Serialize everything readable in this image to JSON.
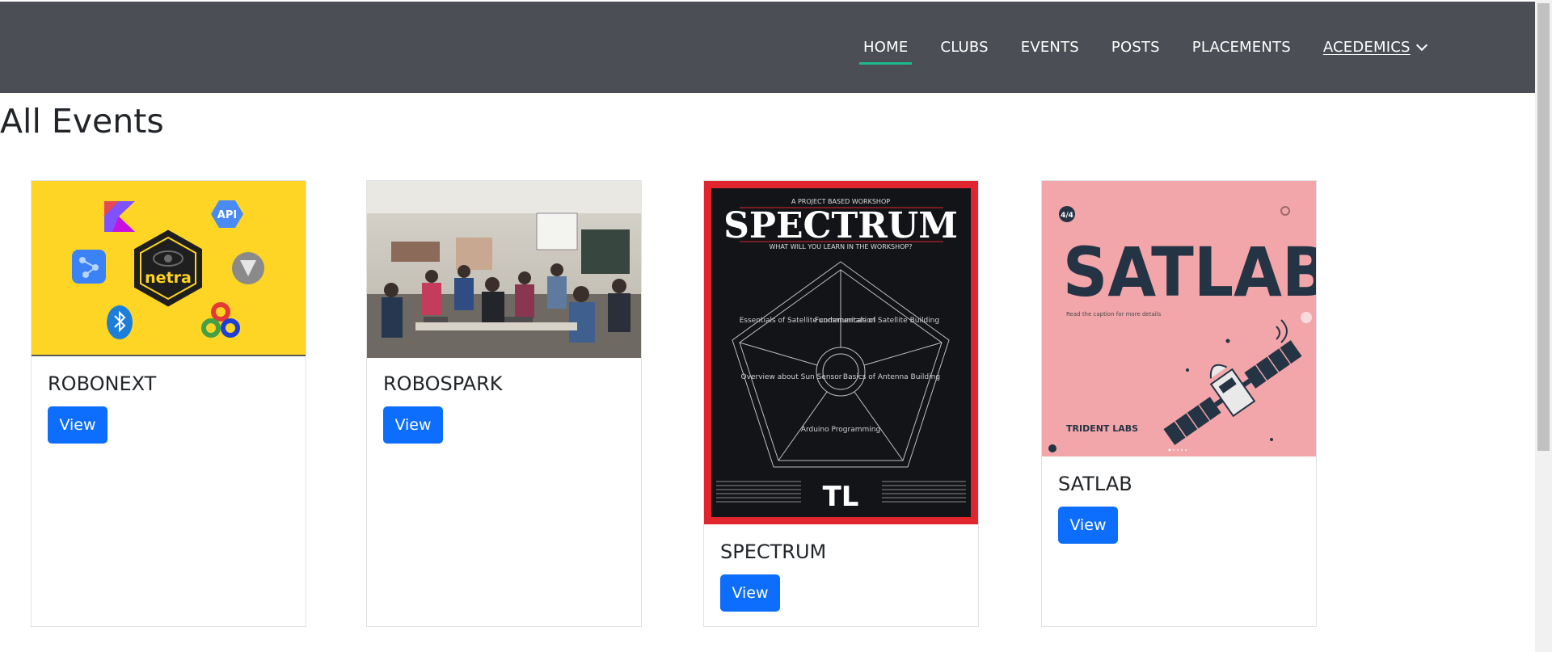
{
  "nav": {
    "home": "HOME",
    "clubs": "CLUBS",
    "events": "EVENTS",
    "posts": "POSTS",
    "placements": "PLACEMENTS",
    "academics": "ACEDEMICS"
  },
  "colors": {
    "navbar": "#4b4f55",
    "active_underline": "#1fb98f",
    "button": "#0d6efd"
  },
  "page": {
    "title": "All Events"
  },
  "events": [
    {
      "title": "ROBONEXT",
      "button": "View",
      "image": {
        "logo_text": "netra",
        "api_badge": "API"
      }
    },
    {
      "title": "ROBOSPARK",
      "button": "View",
      "image": {
        "description": "photo"
      }
    },
    {
      "title": "SPECTRUM",
      "button": "View",
      "image": {
        "kicker": "A PROJECT BASED WORKSHOP",
        "headline": "SPECTRUM",
        "subhead": "WHAT WILL YOU LEARN IN THE WORKSHOP?",
        "topics": [
          "Essentials of Satellite communication",
          "Fundamentals of Satellite Building",
          "Overview about Sun Sensor",
          "Basics of Antenna Building",
          "Arduino Programming"
        ],
        "logo_text": "TL"
      }
    },
    {
      "title": "SATLAB",
      "button": "View",
      "image": {
        "headline": "SATLAB",
        "counter": "4/4",
        "caption": "Read the caption for more details",
        "brand": "TRIDENT LABS"
      }
    }
  ]
}
